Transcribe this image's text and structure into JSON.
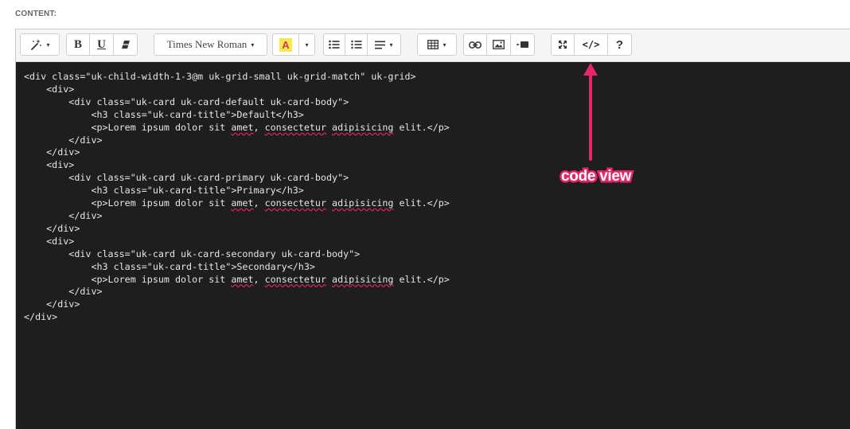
{
  "field_label": "CONTENT:",
  "toolbar": {
    "font_name": "Times New Roman",
    "bold_label": "B",
    "underline_label": "U",
    "help_label": "?",
    "code_view_label": "</>",
    "highlight_letter": "A",
    "caret": "▾"
  },
  "icons": [
    "magic-wand-icon",
    "bold-icon",
    "underline-icon",
    "eraser-icon",
    "text-color-icon",
    "bullet-list-icon",
    "numbered-list-icon",
    "align-icon",
    "table-icon",
    "link-icon",
    "image-icon",
    "video-icon",
    "fullscreen-icon",
    "code-view-icon",
    "help-icon"
  ],
  "code_lines": [
    [
      {
        "t": "<div class=\"uk-child-width-1-3@m uk-grid-small uk-grid-match\" uk-grid>"
      }
    ],
    [
      {
        "t": "    <div>"
      }
    ],
    [
      {
        "t": "        <div class=\"uk-card uk-card-default uk-card-body\">"
      }
    ],
    [
      {
        "t": "            <h3 class=\"uk-card-title\">Default</h3>"
      }
    ],
    [
      {
        "t": "            <p>Lorem ipsum dolor sit "
      },
      {
        "t": "amet",
        "sq": true
      },
      {
        "t": ", "
      },
      {
        "t": "consectetur",
        "sq": true
      },
      {
        "t": " "
      },
      {
        "t": "adipisicing",
        "sq": true
      },
      {
        "t": " elit.</p>"
      }
    ],
    [
      {
        "t": "        </div>"
      }
    ],
    [
      {
        "t": "    </div>"
      }
    ],
    [
      {
        "t": "    <div>"
      }
    ],
    [
      {
        "t": "        <div class=\"uk-card uk-card-primary uk-card-body\">"
      }
    ],
    [
      {
        "t": "            <h3 class=\"uk-card-title\">Primary</h3>"
      }
    ],
    [
      {
        "t": "            <p>Lorem ipsum dolor sit "
      },
      {
        "t": "amet",
        "sq": true
      },
      {
        "t": ", "
      },
      {
        "t": "consectetur",
        "sq": true
      },
      {
        "t": " "
      },
      {
        "t": "adipisicing",
        "sq": true
      },
      {
        "t": " elit.</p>"
      }
    ],
    [
      {
        "t": "        </div>"
      }
    ],
    [
      {
        "t": "    </div>"
      }
    ],
    [
      {
        "t": "    <div>"
      }
    ],
    [
      {
        "t": "        <div class=\"uk-card uk-card-secondary uk-card-body\">"
      }
    ],
    [
      {
        "t": "            <h3 class=\"uk-card-title\">Secondary</h3>"
      }
    ],
    [
      {
        "t": "            <p>Lorem ipsum dolor sit "
      },
      {
        "t": "amet",
        "sq": true
      },
      {
        "t": ", "
      },
      {
        "t": "consectetur",
        "sq": true
      },
      {
        "t": " "
      },
      {
        "t": "adipisicing",
        "sq": true
      },
      {
        "t": " elit.</p>"
      }
    ],
    [
      {
        "t": "        </div>"
      }
    ],
    [
      {
        "t": "    </div>"
      }
    ],
    [
      {
        "t": "</div>"
      }
    ]
  ],
  "annotation": {
    "label": "code view",
    "color": "#e8246a"
  },
  "colors": {
    "code_background": "#1e1e1e",
    "code_text": "#e6e6e6",
    "toolbar_background": "#f5f5f5",
    "spellcheck_underline": "#e0245e",
    "highlight_yellow": "#f7e94a",
    "highlight_letter": "#d6336c"
  }
}
